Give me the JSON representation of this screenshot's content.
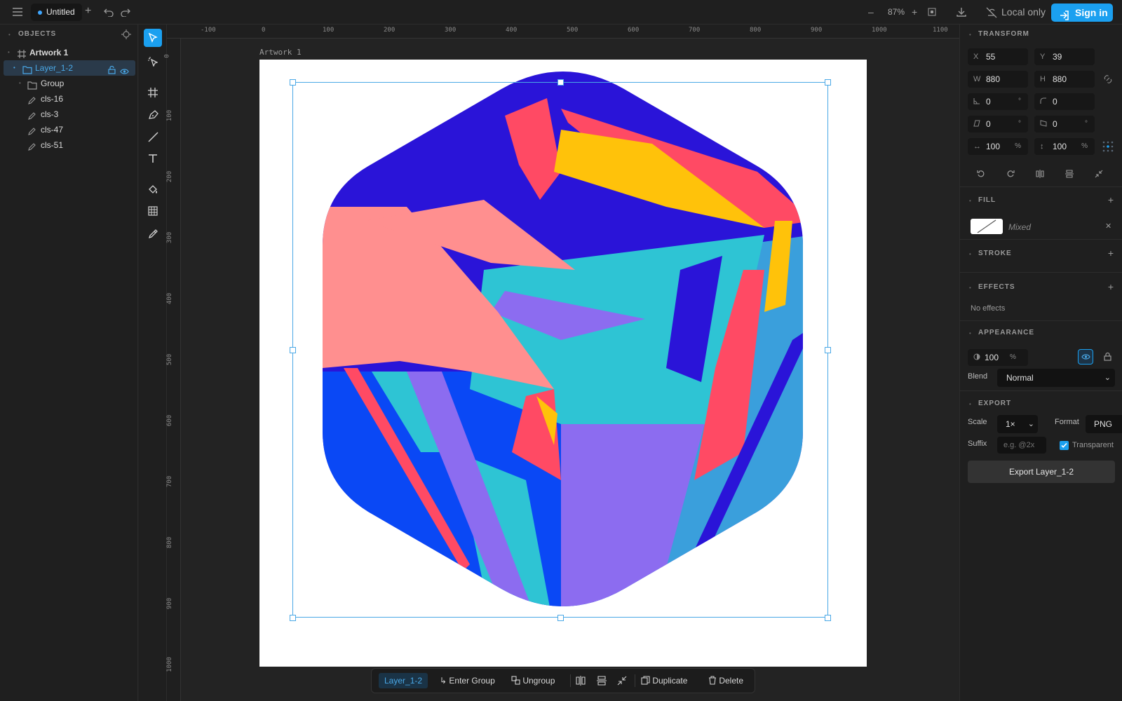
{
  "topbar": {
    "tab_title": "Untitled",
    "zoom": "87%",
    "sync_status": "Local only",
    "sign_in_label": "Sign in"
  },
  "objects_panel": {
    "title": "OBJECTS",
    "items": [
      {
        "label": "Artwork 1",
        "type": "artboard"
      },
      {
        "label": "Layer_1-2",
        "type": "folder",
        "selected": true
      },
      {
        "label": "Group",
        "type": "folder"
      },
      {
        "label": "cls-16",
        "type": "path"
      },
      {
        "label": "cls-3",
        "type": "path"
      },
      {
        "label": "cls-47",
        "type": "path"
      },
      {
        "label": "cls-51",
        "type": "path"
      }
    ]
  },
  "rulers": {
    "top": [
      "-100",
      "0",
      "100",
      "200",
      "300",
      "400",
      "500",
      "600",
      "700",
      "800",
      "900",
      "1000",
      "1100"
    ],
    "left": [
      "0",
      "100",
      "200",
      "300",
      "400",
      "500",
      "600",
      "700",
      "800",
      "900",
      "1000"
    ]
  },
  "canvas": {
    "artboard_label": "Artwork 1"
  },
  "transform": {
    "title": "TRANSFORM",
    "x_label": "X",
    "x": "55",
    "y_label": "Y",
    "y": "39",
    "w_label": "W",
    "w": "880",
    "h_label": "H",
    "h": "880",
    "rotation": "0",
    "rotation_unit": "°",
    "radius": "0",
    "skew_x": "0",
    "skew_x_unit": "°",
    "skew_y": "0",
    "skew_y_unit": "°",
    "scale_x": "100",
    "scale_x_unit": "%",
    "scale_y": "100",
    "scale_y_unit": "%"
  },
  "fill": {
    "title": "FILL",
    "value": "Mixed"
  },
  "stroke": {
    "title": "STROKE"
  },
  "effects": {
    "title": "EFFECTS",
    "empty_text": "No effects"
  },
  "appearance": {
    "title": "APPEARANCE",
    "opacity": "100",
    "opacity_unit": "%",
    "blend_label": "Blend",
    "blend_value": "Normal"
  },
  "export": {
    "title": "EXPORT",
    "scale_label": "Scale",
    "scale_value": "1×",
    "format_label": "Format",
    "format_value": "PNG",
    "suffix_label": "Suffix",
    "suffix_placeholder": "e.g. @2x",
    "transparent_label": "Transparent",
    "transparent_checked": true,
    "export_button": "Export Layer_1-2"
  },
  "selection_bar": {
    "layer_chip": "Layer_1-2",
    "enter_group": "Enter Group",
    "ungroup": "Ungroup",
    "duplicate": "Duplicate",
    "delete": "Delete"
  },
  "colors": {
    "accent": "#1ba0f0",
    "selection": "#4aa8e6",
    "indigo": "#2a14d8",
    "coral": "#ff4a64",
    "salmon": "#ff8f8f",
    "yellow": "#ffc20a",
    "cyan": "#2ec4d4",
    "sky": "#3a9fdc",
    "violet": "#8c6cf0",
    "blue": "#0a48f5"
  }
}
